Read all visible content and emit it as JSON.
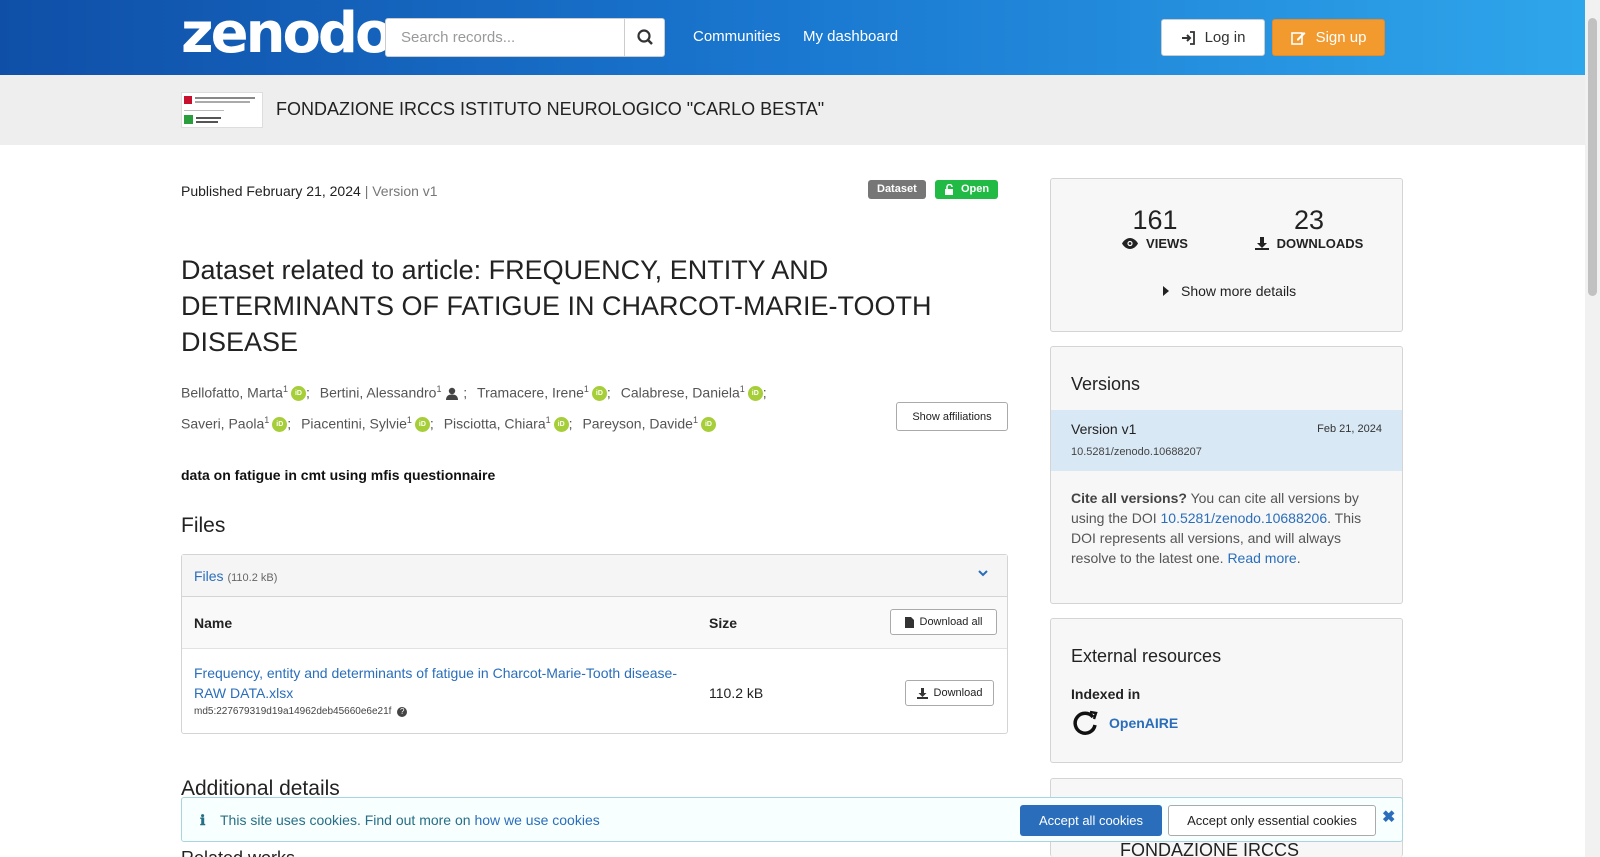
{
  "header": {
    "logo_text": "zenodo",
    "search_placeholder": "Search records...",
    "nav": [
      "Communities",
      "My dashboard"
    ],
    "login_label": "Log in",
    "signup_label": "Sign up"
  },
  "community": {
    "name": "FONDAZIONE IRCCS ISTITUTO NEUROLOGICO \"CARLO BESTA\""
  },
  "record": {
    "published": "Published February 21, 2024",
    "version": "| Version v1",
    "badges": [
      "Dataset",
      "Open"
    ],
    "title": "Dataset related to article: FREQUENCY, ENTITY AND DETERMINANTS OF FATIGUE IN CHARCOT-MARIE-TOOTH DISEASE",
    "creators": [
      {
        "name": "Bellofatto, Marta",
        "aff": "1",
        "icon": "orcid"
      },
      {
        "name": "Bertini, Alessandro",
        "aff": "1",
        "icon": "person"
      },
      {
        "name": "Tramacere, Irene",
        "aff": "1",
        "icon": "orcid"
      },
      {
        "name": "Calabrese, Daniela",
        "aff": "1",
        "icon": "orcid"
      },
      {
        "name": "Saveri, Paola",
        "aff": "1",
        "icon": "orcid"
      },
      {
        "name": "Piacentini, Sylvie",
        "aff": "1",
        "icon": "orcid"
      },
      {
        "name": "Pisciotta, Chiara",
        "aff": "1",
        "icon": "orcid"
      },
      {
        "name": "Pareyson, Davide",
        "aff": "1",
        "icon": "orcid"
      }
    ],
    "show_affiliations": "Show affiliations",
    "description": "data on fatigue in cmt using mfis questionnaire"
  },
  "files": {
    "heading": "Files",
    "panel_label": "Files",
    "panel_size": "(110.2 kB)",
    "col_name": "Name",
    "col_size": "Size",
    "download_all": "Download all",
    "items": [
      {
        "name": "Frequency, entity and determinants of fatigue in Charcot-Marie-Tooth disease-RAW DATA.xlsx",
        "md5": "md5:227679319d19a14962deb45660e6e21f",
        "size": "110.2 kB",
        "download": "Download"
      }
    ]
  },
  "additional_details": "Additional details",
  "related_partial": "Related works",
  "stats": {
    "views": "161",
    "views_label": "VIEWS",
    "downloads": "23",
    "downloads_label": "DOWNLOADS",
    "show_more": "Show more details"
  },
  "versions": {
    "title": "Versions",
    "current_label": "Version v1",
    "current_date": "Feb 21, 2024",
    "current_doi": "10.5281/zenodo.10688207",
    "cite_bold": "Cite all versions?",
    "cite_pre": " You can cite all versions by using the DOI ",
    "cite_doi": "10.5281/zenodo.10688206",
    "cite_post": ". This DOI represents all versions, and will always resolve to the latest one. ",
    "read_more": "Read more"
  },
  "external": {
    "title": "External resources",
    "indexed_in": "Indexed in",
    "openaire": "OpenAIRE"
  },
  "sidebar_partial": "FONDAZIONE IRCCS",
  "cookies": {
    "text": "This site uses cookies. Find out more on ",
    "link": "how we use cookies",
    "accept_all": "Accept all cookies",
    "accept_essential": "Accept only essential cookies"
  },
  "colors": {
    "accent": "#2a6ebb",
    "signup": "#f29a2e",
    "open_badge": "#21ba45",
    "dataset_badge": "#767676",
    "orcid": "#a6ce39"
  }
}
